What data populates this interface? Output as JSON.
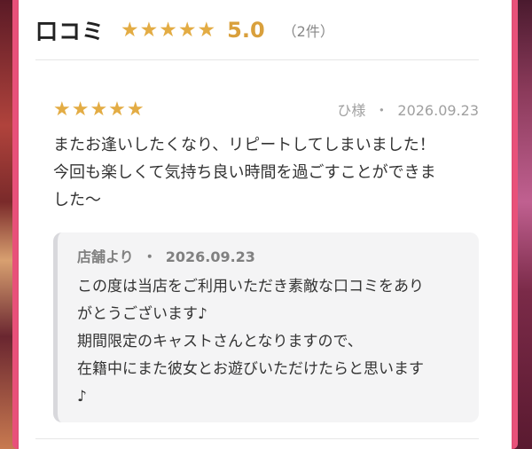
{
  "header": {
    "title": "口コミ",
    "stars": "★★★★★",
    "score": "5.0",
    "count": "（2件）"
  },
  "review": {
    "stars": "★★★★★",
    "author": "ひ様",
    "separator": "・",
    "date": "2026.09.23",
    "body_lines": [
      "またお逢いしたくなり、リピートしてしまいました！",
      "今回も楽しくて気持ち良い時間を過ごすことができま",
      "した〜"
    ]
  },
  "reply": {
    "from": "店舗より",
    "separator": "・",
    "date": "2026.09.23",
    "body_lines": [
      "この度は当店をご利用いただき素敵な口コミをあり",
      "がとうございます♪",
      "期間限定のキャストさんとなりますので、",
      "在籍中にまた彼女とお遊びいただけたらと思います",
      "♪"
    ]
  },
  "colors": {
    "star": "#e3ac44",
    "score": "#d9a03c",
    "frame_accent": "#e8517a"
  }
}
